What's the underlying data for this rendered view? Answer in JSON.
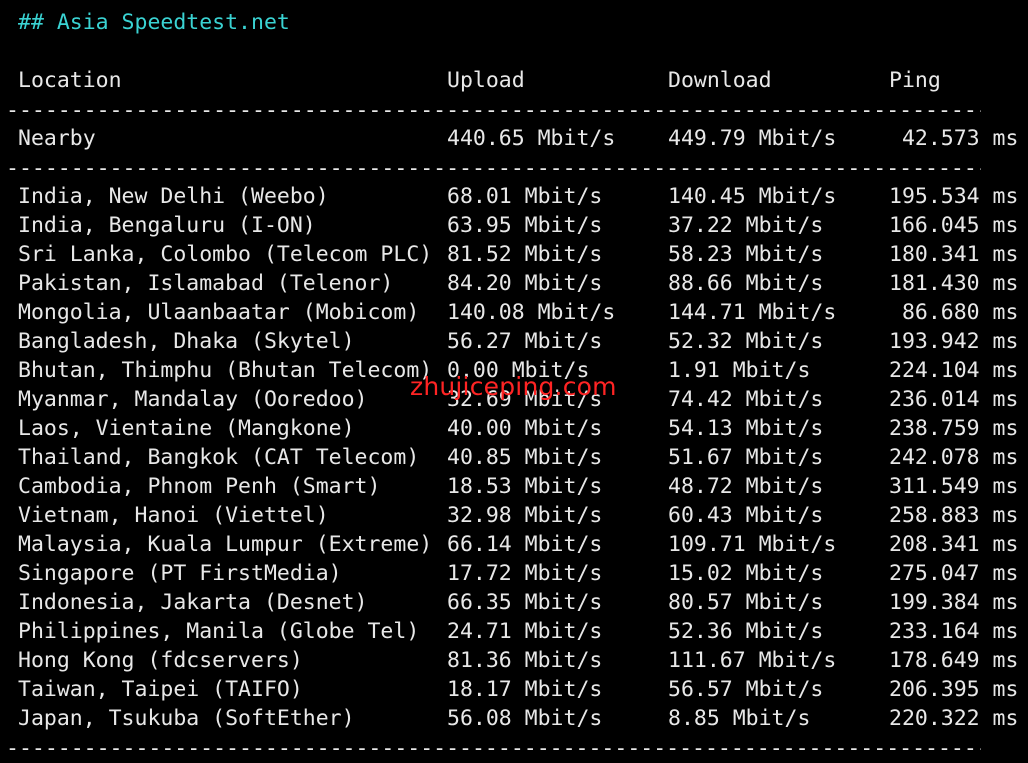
{
  "heading": "## Asia Speedtest.net",
  "columns": {
    "location": "Location",
    "upload": "Upload",
    "download": "Download",
    "ping": "Ping"
  },
  "separator": "----------------------------------------------------------------------------------------------------------------------------",
  "nearby": {
    "location": "Nearby",
    "upload": "440.65 Mbit/s",
    "download": "449.79 Mbit/s",
    "ping": " 42.573 ms"
  },
  "rows": [
    {
      "location": "India, New Delhi (Weebo)",
      "upload": "68.01 Mbit/s",
      "download": "140.45 Mbit/s",
      "ping": "195.534 ms"
    },
    {
      "location": "India, Bengaluru (I-ON)",
      "upload": "63.95 Mbit/s",
      "download": "37.22 Mbit/s",
      "ping": "166.045 ms"
    },
    {
      "location": "Sri Lanka, Colombo (Telecom PLC)",
      "upload": "81.52 Mbit/s",
      "download": "58.23 Mbit/s",
      "ping": "180.341 ms"
    },
    {
      "location": "Pakistan, Islamabad (Telenor)",
      "upload": "84.20 Mbit/s",
      "download": "88.66 Mbit/s",
      "ping": "181.430 ms"
    },
    {
      "location": "Mongolia, Ulaanbaatar (Mobicom)",
      "upload": "140.08 Mbit/s",
      "download": "144.71 Mbit/s",
      "ping": " 86.680 ms"
    },
    {
      "location": "Bangladesh, Dhaka (Skytel)",
      "upload": "56.27 Mbit/s",
      "download": "52.32 Mbit/s",
      "ping": "193.942 ms"
    },
    {
      "location": "Bhutan, Thimphu (Bhutan Telecom)",
      "upload": "0.00 Mbit/s",
      "download": "1.91 Mbit/s",
      "ping": "224.104 ms"
    },
    {
      "location": "Myanmar, Mandalay (Ooredoo)",
      "upload": "32.69 Mbit/s",
      "download": "74.42 Mbit/s",
      "ping": "236.014 ms"
    },
    {
      "location": "Laos, Vientaine (Mangkone)",
      "upload": "40.00 Mbit/s",
      "download": "54.13 Mbit/s",
      "ping": "238.759 ms"
    },
    {
      "location": "Thailand, Bangkok (CAT Telecom)",
      "upload": "40.85 Mbit/s",
      "download": "51.67 Mbit/s",
      "ping": "242.078 ms"
    },
    {
      "location": "Cambodia, Phnom Penh (Smart)",
      "upload": "18.53 Mbit/s",
      "download": "48.72 Mbit/s",
      "ping": "311.549 ms"
    },
    {
      "location": "Vietnam, Hanoi (Viettel)",
      "upload": "32.98 Mbit/s",
      "download": "60.43 Mbit/s",
      "ping": "258.883 ms"
    },
    {
      "location": "Malaysia, Kuala Lumpur (Extreme)",
      "upload": "66.14 Mbit/s",
      "download": "109.71 Mbit/s",
      "ping": "208.341 ms"
    },
    {
      "location": "Singapore (PT FirstMedia)",
      "upload": "17.72 Mbit/s",
      "download": "15.02 Mbit/s",
      "ping": "275.047 ms"
    },
    {
      "location": "Indonesia, Jakarta (Desnet)",
      "upload": "66.35 Mbit/s",
      "download": "80.57 Mbit/s",
      "ping": "199.384 ms"
    },
    {
      "location": "Philippines, Manila (Globe Tel)",
      "upload": "24.71 Mbit/s",
      "download": "52.36 Mbit/s",
      "ping": "233.164 ms"
    },
    {
      "location": "Hong Kong (fdcservers)",
      "upload": "81.36 Mbit/s",
      "download": "111.67 Mbit/s",
      "ping": "178.649 ms"
    },
    {
      "location": "Taiwan, Taipei (TAIFO)",
      "upload": "18.17 Mbit/s",
      "download": "56.57 Mbit/s",
      "ping": "206.395 ms"
    },
    {
      "location": "Japan, Tsukuba (SoftEther)",
      "upload": "56.08 Mbit/s",
      "download": "8.85 Mbit/s",
      "ping": "220.322 ms"
    }
  ],
  "watermark": "zhujiceping.com",
  "colors": {
    "background": "#000000",
    "text": "#e8e8e8",
    "heading": "#3ad3d3",
    "watermark": "#ff2424"
  }
}
